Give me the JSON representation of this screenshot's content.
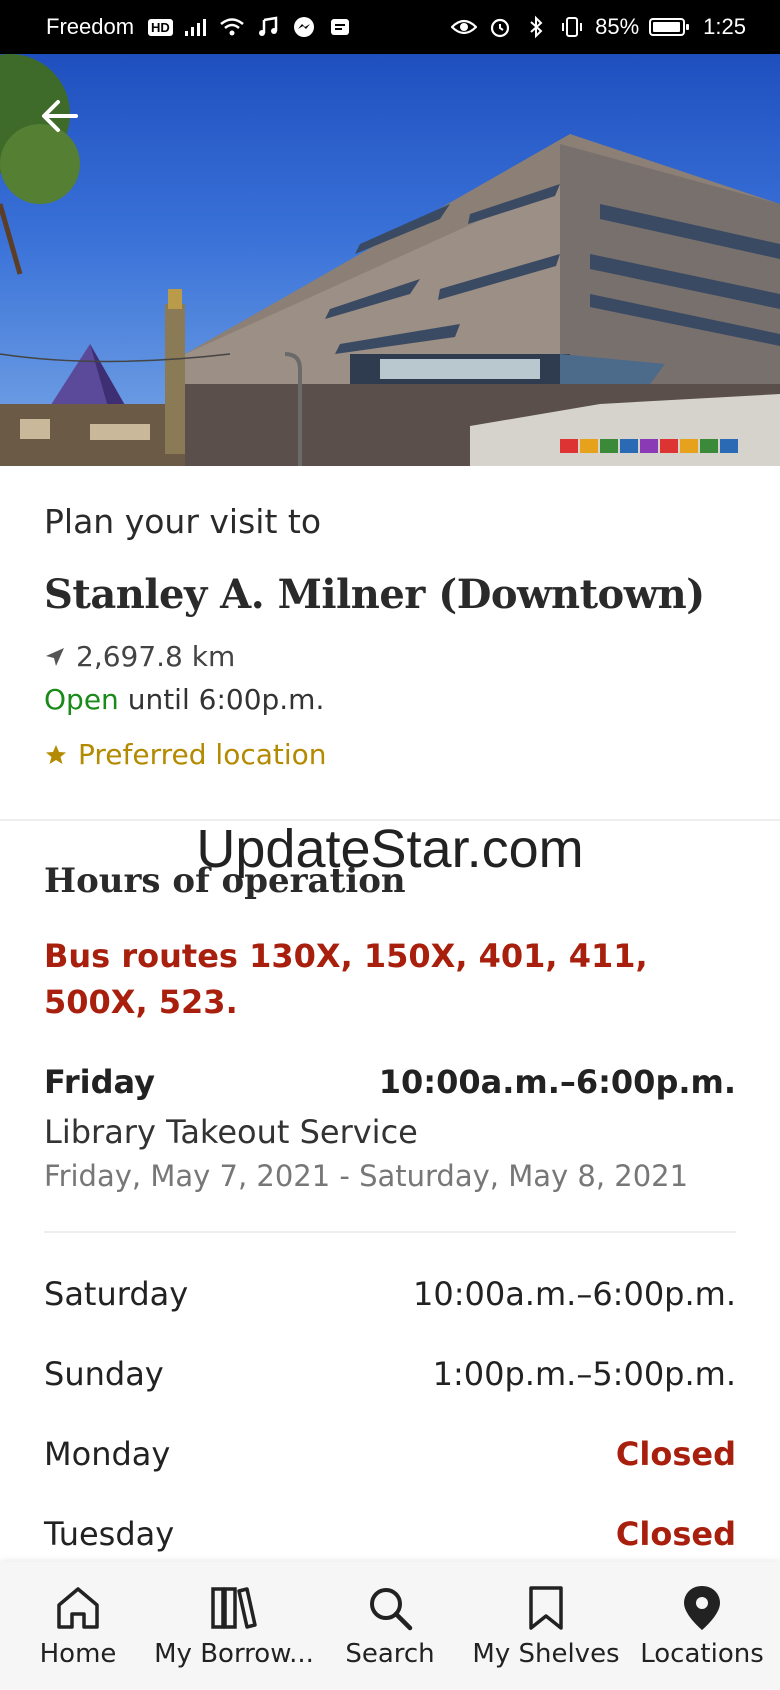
{
  "status_bar": {
    "carrier": "Freedom",
    "hd": "HD",
    "battery": "85%",
    "time": "1:25"
  },
  "header": {
    "eyebrow": "Plan your visit to",
    "title": "Stanley A. Milner (Downtown)",
    "distance": "2,697.8 km",
    "status_word": "Open",
    "status_rest": " until 6:00p.m.",
    "preferred": "Preferred location"
  },
  "watermark": "UpdateStar.com",
  "hours": {
    "section_title": "Hours of operation",
    "bus_routes": "Bus routes 130X, 150X, 401, 411, 500X, 523.",
    "today": {
      "day": "Friday",
      "time": "10:00a.m.–6:00p.m.",
      "service": "Library Takeout Service",
      "service_dates": "Friday, May 7, 2021 - Saturday, May 8, 2021"
    },
    "days": [
      {
        "day": "Saturday",
        "time": "10:00a.m.–6:00p.m."
      },
      {
        "day": "Sunday",
        "time": "1:00p.m.–5:00p.m."
      },
      {
        "day": "Monday",
        "time": "Closed"
      },
      {
        "day": "Tuesday",
        "time": "Closed"
      }
    ]
  },
  "bottom_nav": [
    {
      "label": "Home",
      "icon": "home-icon"
    },
    {
      "label": "My Borrow...",
      "icon": "books-icon"
    },
    {
      "label": "Search",
      "icon": "search-icon"
    },
    {
      "label": "My Shelves",
      "icon": "bookmark-icon"
    },
    {
      "label": "Locations",
      "icon": "location-pin-icon"
    }
  ],
  "colors": {
    "open": "#1a8a1a",
    "closed": "#a8200d",
    "preferred": "#b38a00"
  }
}
